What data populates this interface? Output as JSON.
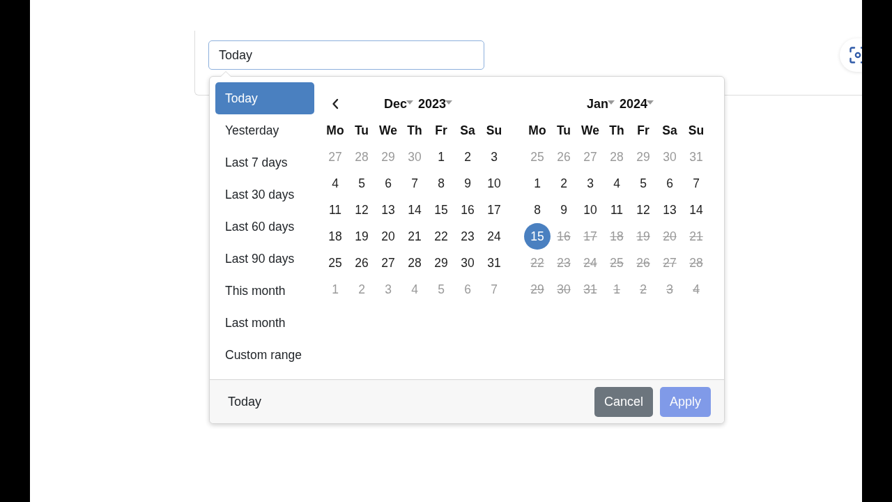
{
  "card": {
    "date_input": {
      "value": "Today"
    }
  },
  "ranges": [
    {
      "label": "Today",
      "selected": true
    },
    {
      "label": "Yesterday",
      "selected": false
    },
    {
      "label": "Last 7 days",
      "selected": false
    },
    {
      "label": "Last 30 days",
      "selected": false
    },
    {
      "label": "Last 60 days",
      "selected": false
    },
    {
      "label": "Last 90 days",
      "selected": false
    },
    {
      "label": "This month",
      "selected": false
    },
    {
      "label": "Last month",
      "selected": false
    },
    {
      "label": "Custom range",
      "selected": false
    }
  ],
  "calendars": [
    {
      "show_prev": true,
      "month": "Dec",
      "year": "2023",
      "weekdays": [
        "Mo",
        "Tu",
        "We",
        "Th",
        "Fr",
        "Sa",
        "Su"
      ],
      "weeks": [
        [
          {
            "day": "27",
            "kind": "off",
            "selected": false
          },
          {
            "day": "28",
            "kind": "off",
            "selected": false
          },
          {
            "day": "29",
            "kind": "off",
            "selected": false
          },
          {
            "day": "30",
            "kind": "off",
            "selected": false
          },
          {
            "day": "1",
            "kind": "day",
            "selected": false
          },
          {
            "day": "2",
            "kind": "day",
            "selected": false
          },
          {
            "day": "3",
            "kind": "day",
            "selected": false
          }
        ],
        [
          {
            "day": "4",
            "kind": "day",
            "selected": false
          },
          {
            "day": "5",
            "kind": "day",
            "selected": false
          },
          {
            "day": "6",
            "kind": "day",
            "selected": false
          },
          {
            "day": "7",
            "kind": "day",
            "selected": false
          },
          {
            "day": "8",
            "kind": "day",
            "selected": false
          },
          {
            "day": "9",
            "kind": "day",
            "selected": false
          },
          {
            "day": "10",
            "kind": "day",
            "selected": false
          }
        ],
        [
          {
            "day": "11",
            "kind": "day",
            "selected": false
          },
          {
            "day": "12",
            "kind": "day",
            "selected": false
          },
          {
            "day": "13",
            "kind": "day",
            "selected": false
          },
          {
            "day": "14",
            "kind": "day",
            "selected": false
          },
          {
            "day": "15",
            "kind": "day",
            "selected": false
          },
          {
            "day": "16",
            "kind": "day",
            "selected": false
          },
          {
            "day": "17",
            "kind": "day",
            "selected": false
          }
        ],
        [
          {
            "day": "18",
            "kind": "day",
            "selected": false
          },
          {
            "day": "19",
            "kind": "day",
            "selected": false
          },
          {
            "day": "20",
            "kind": "day",
            "selected": false
          },
          {
            "day": "21",
            "kind": "day",
            "selected": false
          },
          {
            "day": "22",
            "kind": "day",
            "selected": false
          },
          {
            "day": "23",
            "kind": "day",
            "selected": false
          },
          {
            "day": "24",
            "kind": "day",
            "selected": false
          }
        ],
        [
          {
            "day": "25",
            "kind": "day",
            "selected": false
          },
          {
            "day": "26",
            "kind": "day",
            "selected": false
          },
          {
            "day": "27",
            "kind": "day",
            "selected": false
          },
          {
            "day": "28",
            "kind": "day",
            "selected": false
          },
          {
            "day": "29",
            "kind": "day",
            "selected": false
          },
          {
            "day": "30",
            "kind": "day",
            "selected": false
          },
          {
            "day": "31",
            "kind": "day",
            "selected": false
          }
        ],
        [
          {
            "day": "1",
            "kind": "off",
            "selected": false
          },
          {
            "day": "2",
            "kind": "off",
            "selected": false
          },
          {
            "day": "3",
            "kind": "off",
            "selected": false
          },
          {
            "day": "4",
            "kind": "off",
            "selected": false
          },
          {
            "day": "5",
            "kind": "off",
            "selected": false
          },
          {
            "day": "6",
            "kind": "off",
            "selected": false
          },
          {
            "day": "7",
            "kind": "off",
            "selected": false
          }
        ]
      ]
    },
    {
      "show_prev": false,
      "month": "Jan",
      "year": "2024",
      "weekdays": [
        "Mo",
        "Tu",
        "We",
        "Th",
        "Fr",
        "Sa",
        "Su"
      ],
      "weeks": [
        [
          {
            "day": "25",
            "kind": "off",
            "selected": false
          },
          {
            "day": "26",
            "kind": "off",
            "selected": false
          },
          {
            "day": "27",
            "kind": "off",
            "selected": false
          },
          {
            "day": "28",
            "kind": "off",
            "selected": false
          },
          {
            "day": "29",
            "kind": "off",
            "selected": false
          },
          {
            "day": "30",
            "kind": "off",
            "selected": false
          },
          {
            "day": "31",
            "kind": "off",
            "selected": false
          }
        ],
        [
          {
            "day": "1",
            "kind": "day",
            "selected": false
          },
          {
            "day": "2",
            "kind": "day",
            "selected": false
          },
          {
            "day": "3",
            "kind": "day",
            "selected": false
          },
          {
            "day": "4",
            "kind": "day",
            "selected": false
          },
          {
            "day": "5",
            "kind": "day",
            "selected": false
          },
          {
            "day": "6",
            "kind": "day",
            "selected": false
          },
          {
            "day": "7",
            "kind": "day",
            "selected": false
          }
        ],
        [
          {
            "day": "8",
            "kind": "day",
            "selected": false
          },
          {
            "day": "9",
            "kind": "day",
            "selected": false
          },
          {
            "day": "10",
            "kind": "day",
            "selected": false
          },
          {
            "day": "11",
            "kind": "day",
            "selected": false
          },
          {
            "day": "12",
            "kind": "day",
            "selected": false
          },
          {
            "day": "13",
            "kind": "day",
            "selected": false
          },
          {
            "day": "14",
            "kind": "day",
            "selected": false
          }
        ],
        [
          {
            "day": "15",
            "kind": "day",
            "selected": true
          },
          {
            "day": "16",
            "kind": "disabled",
            "selected": false
          },
          {
            "day": "17",
            "kind": "disabled",
            "selected": false
          },
          {
            "day": "18",
            "kind": "disabled",
            "selected": false
          },
          {
            "day": "19",
            "kind": "disabled",
            "selected": false
          },
          {
            "day": "20",
            "kind": "disabled",
            "selected": false
          },
          {
            "day": "21",
            "kind": "disabled",
            "selected": false
          }
        ],
        [
          {
            "day": "22",
            "kind": "disabled",
            "selected": false
          },
          {
            "day": "23",
            "kind": "disabled",
            "selected": false
          },
          {
            "day": "24",
            "kind": "disabled",
            "selected": false
          },
          {
            "day": "25",
            "kind": "disabled",
            "selected": false
          },
          {
            "day": "26",
            "kind": "disabled",
            "selected": false
          },
          {
            "day": "27",
            "kind": "disabled",
            "selected": false
          },
          {
            "day": "28",
            "kind": "disabled",
            "selected": false
          }
        ],
        [
          {
            "day": "29",
            "kind": "disabled",
            "selected": false
          },
          {
            "day": "30",
            "kind": "disabled",
            "selected": false
          },
          {
            "day": "31",
            "kind": "disabled",
            "selected": false
          },
          {
            "day": "1",
            "kind": "disabled",
            "selected": false
          },
          {
            "day": "2",
            "kind": "disabled",
            "selected": false
          },
          {
            "day": "3",
            "kind": "disabled",
            "selected": false
          },
          {
            "day": "4",
            "kind": "disabled",
            "selected": false
          }
        ]
      ]
    }
  ],
  "footer": {
    "selected_range": "Today",
    "buttons": [
      {
        "label": "Cancel",
        "kind": "secondary",
        "disabled": false
      },
      {
        "label": "Apply",
        "kind": "primary",
        "disabled": true
      }
    ]
  }
}
